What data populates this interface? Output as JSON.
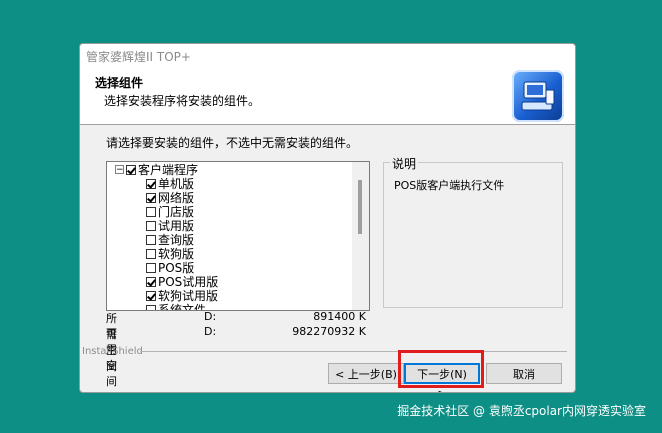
{
  "window": {
    "title": "管家婆辉煌II TOP+",
    "header_title": "选择组件",
    "header_subtitle": "选择安装程序将安装的组件。",
    "header_icon": "installer-computer-icon"
  },
  "instruction": "请选择要安装的组件，不选中无需安装的组件。",
  "components": {
    "root": {
      "label": "客户端程序",
      "checked": true,
      "expander": "−"
    },
    "items": [
      {
        "label": "单机版",
        "checked": true
      },
      {
        "label": "网络版",
        "checked": true
      },
      {
        "label": "门店版",
        "checked": false
      },
      {
        "label": "试用版",
        "checked": false
      },
      {
        "label": "查询版",
        "checked": false
      },
      {
        "label": "软狗版",
        "checked": false
      },
      {
        "label": "POS版",
        "checked": false
      },
      {
        "label": "POS试用版",
        "checked": true
      },
      {
        "label": "软狗试用版",
        "checked": true
      },
      {
        "label": "系统文件",
        "checked": false
      }
    ]
  },
  "description": {
    "legend": "说明",
    "text": "POS版客户端执行文件"
  },
  "space": {
    "required_label": "所需空间",
    "required_drive": "D:",
    "required_value": "891400 K",
    "available_label": "可用空间",
    "available_drive": "D:",
    "available_value": "982270932 K"
  },
  "footer": {
    "brand": "InstallShield",
    "back_label": "< 上一步(B)",
    "next_label": "下一步(N) >",
    "cancel_label": "取消"
  },
  "watermark": "掘金技术社区 @ 袁煦丞cpolar内网穿透实验室",
  "colors": {
    "desktop": "#0e8f86",
    "highlight": "#e01d1d"
  }
}
